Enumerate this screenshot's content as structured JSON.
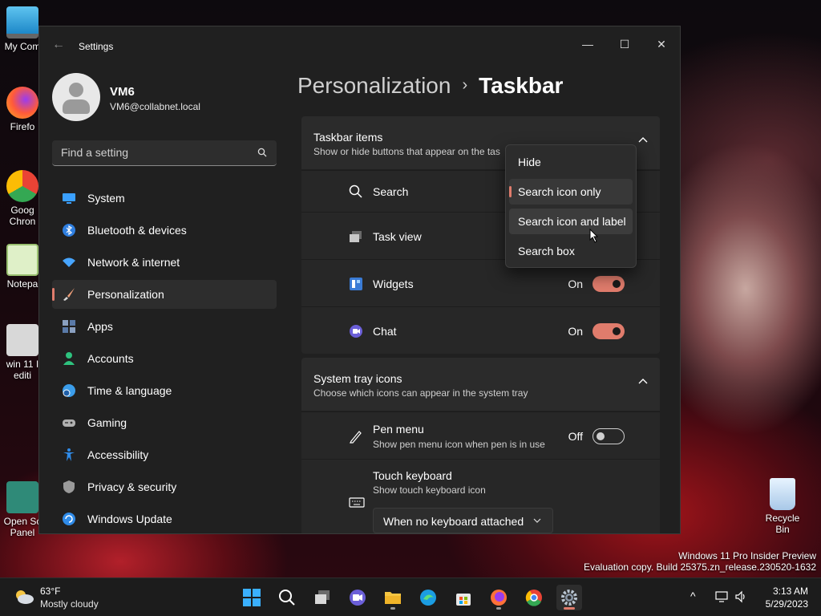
{
  "desktop": {
    "icons": [
      {
        "label": "My Com"
      },
      {
        "label": "Firefo"
      },
      {
        "label": "Goog Chron"
      },
      {
        "label": "Notepa"
      },
      {
        "label": "win 11 I editi"
      },
      {
        "label": "Open Sc Panel"
      },
      {
        "label": "Recycle Bin"
      }
    ],
    "watermark": {
      "line1": "Windows 11 Pro Insider Preview",
      "line2": "Evaluation copy. Build 25375.zn_release.230520-1632"
    }
  },
  "window": {
    "title": "Settings",
    "back_glyph": "←",
    "minimize_glyph": "—",
    "maximize_glyph": "☐",
    "close_glyph": "✕"
  },
  "profile": {
    "name": "VM6",
    "email": "VM6@collabnet.local"
  },
  "search": {
    "placeholder": "Find a setting"
  },
  "sidebar": {
    "items": [
      {
        "label": "System",
        "icon": "system-icon",
        "color": "#3aa0ff"
      },
      {
        "label": "Bluetooth & devices",
        "icon": "bluetooth-icon",
        "color": "#2f7fe0"
      },
      {
        "label": "Network & internet",
        "icon": "wifi-icon",
        "color": "#47a5ff"
      },
      {
        "label": "Personalization",
        "icon": "brush-icon",
        "color": "#f0a07a",
        "active": true
      },
      {
        "label": "Apps",
        "icon": "apps-icon",
        "color": "#8aa0c0"
      },
      {
        "label": "Accounts",
        "icon": "accounts-icon",
        "color": "#2ec27e"
      },
      {
        "label": "Time & language",
        "icon": "globe-clock-icon",
        "color": "#3b9dea"
      },
      {
        "label": "Gaming",
        "icon": "gamepad-icon",
        "color": "#b0b0b0"
      },
      {
        "label": "Accessibility",
        "icon": "accessibility-icon",
        "color": "#2f8be8"
      },
      {
        "label": "Privacy & security",
        "icon": "shield-icon",
        "color": "#9a9a9a"
      },
      {
        "label": "Windows Update",
        "icon": "update-icon",
        "color": "#2f8be8"
      }
    ]
  },
  "breadcrumb": {
    "parent": "Personalization",
    "separator": "›",
    "current": "Taskbar"
  },
  "taskbar_items": {
    "title": "Taskbar items",
    "subtitle": "Show or hide buttons that appear on the tas",
    "rows": [
      {
        "label": "Search",
        "icon": "search-icon"
      },
      {
        "label": "Task view",
        "icon": "task-view-icon"
      },
      {
        "label": "Widgets",
        "icon": "widgets-icon",
        "state": "On",
        "toggle": true
      },
      {
        "label": "Chat",
        "icon": "chat-icon",
        "state": "On",
        "toggle": true
      }
    ]
  },
  "system_tray": {
    "title": "System tray icons",
    "subtitle": "Choose which icons can appear in the system tray",
    "rows": [
      {
        "label": "Pen menu",
        "sublabel": "Show pen menu icon when pen is in use",
        "state": "Off",
        "toggle": false,
        "icon": "pen-icon"
      },
      {
        "label": "Touch keyboard",
        "sublabel": "Show touch keyboard icon",
        "dropdown_value": "When no keyboard attached",
        "icon": "keyboard-icon"
      }
    ]
  },
  "search_popup": {
    "options": [
      {
        "label": "Hide"
      },
      {
        "label": "Search icon only",
        "selected": true
      },
      {
        "label": "Search icon and label",
        "hover": true
      },
      {
        "label": "Search box"
      }
    ]
  },
  "taskbar": {
    "weather": {
      "temp": "63°F",
      "condition": "Mostly cloudy"
    },
    "clock": {
      "time": "3:13 AM",
      "date": "5/29/2023"
    },
    "pinned": [
      {
        "icon": "start-icon"
      },
      {
        "icon": "search-icon"
      },
      {
        "icon": "task-view-icon"
      },
      {
        "icon": "chat-icon"
      },
      {
        "icon": "file-explorer-icon"
      },
      {
        "icon": "edge-icon"
      },
      {
        "icon": "store-icon"
      },
      {
        "icon": "firefox-icon"
      },
      {
        "icon": "chrome-icon"
      },
      {
        "icon": "settings-icon"
      }
    ],
    "tray_glyph": "^"
  },
  "colors": {
    "accent": "#e07c6c",
    "window_bg": "#202020",
    "card_bg": "#2b2b2b"
  }
}
